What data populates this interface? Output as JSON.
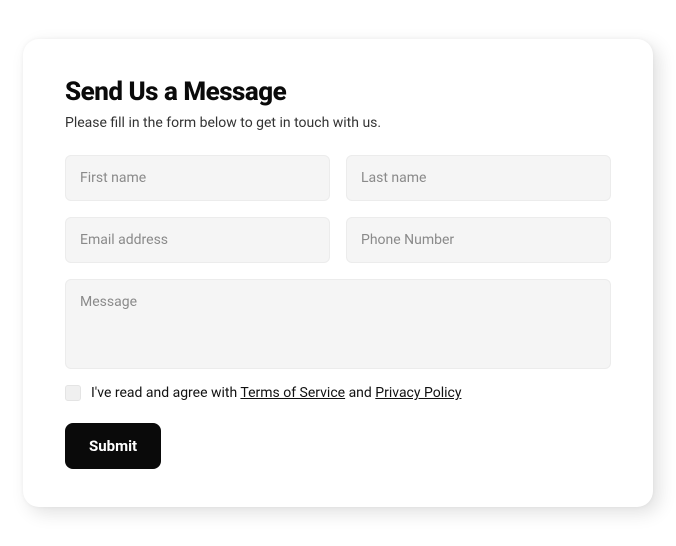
{
  "form": {
    "title": "Send Us a Message",
    "subtitle": "Please fill in the form below to get in touch with us.",
    "fields": {
      "first_name": {
        "placeholder": "First name",
        "value": ""
      },
      "last_name": {
        "placeholder": "Last name",
        "value": ""
      },
      "email": {
        "placeholder": "Email address",
        "value": ""
      },
      "phone": {
        "placeholder": "Phone Number",
        "value": ""
      },
      "message": {
        "placeholder": "Message",
        "value": ""
      }
    },
    "consent": {
      "checked": false,
      "prefix": "I've read and agree with ",
      "terms_label": "Terms of Service",
      "middle": " and ",
      "privacy_label": "Privacy Policy"
    },
    "submit_label": "Submit"
  }
}
